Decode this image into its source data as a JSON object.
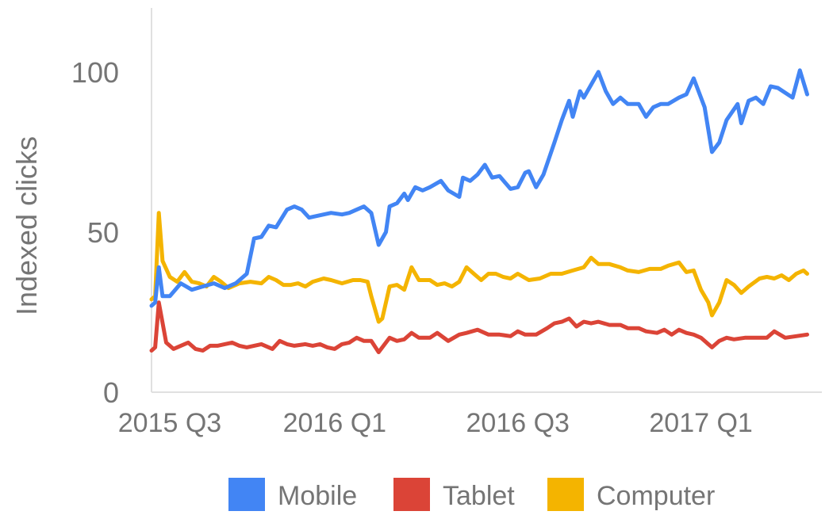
{
  "chart_data": {
    "type": "line",
    "ylabel": "Indexed clicks",
    "xlabel": "",
    "ylim": [
      0,
      120
    ],
    "y_ticks": [
      "0",
      "50",
      "100"
    ],
    "x_ticks": [
      "2015 Q3",
      "2016 Q1",
      "2016 Q3",
      "2017 Q1"
    ],
    "x_range": [
      2015.5,
      2017.33
    ],
    "grid": false,
    "legend_position": "bottom",
    "series": [
      {
        "name": "Mobile",
        "color": "#4285f4",
        "points": [
          [
            2015.5,
            27.0
          ],
          [
            2015.51,
            28.0
          ],
          [
            2015.52,
            39.0
          ],
          [
            2015.53,
            30.0
          ],
          [
            2015.55,
            30.0
          ],
          [
            2015.58,
            34.0
          ],
          [
            2015.61,
            32.0
          ],
          [
            2015.64,
            33.0
          ],
          [
            2015.67,
            34.0
          ],
          [
            2015.7,
            32.5
          ],
          [
            2015.73,
            34.0
          ],
          [
            2015.76,
            37.0
          ],
          [
            2015.78,
            48.0
          ],
          [
            2015.8,
            48.5
          ],
          [
            2015.82,
            52.0
          ],
          [
            2015.84,
            51.5
          ],
          [
            2015.87,
            57.0
          ],
          [
            2015.89,
            58.0
          ],
          [
            2015.91,
            57.0
          ],
          [
            2015.93,
            54.5
          ],
          [
            2015.95,
            55.0
          ],
          [
            2015.97,
            55.5
          ],
          [
            2015.99,
            56.0
          ],
          [
            2016.02,
            55.5
          ],
          [
            2016.04,
            56.0
          ],
          [
            2016.06,
            57.0
          ],
          [
            2016.08,
            58.0
          ],
          [
            2016.1,
            56.0
          ],
          [
            2016.12,
            46.0
          ],
          [
            2016.14,
            50.0
          ],
          [
            2016.15,
            58.0
          ],
          [
            2016.17,
            59.0
          ],
          [
            2016.19,
            62.0
          ],
          [
            2016.2,
            60.0
          ],
          [
            2016.22,
            64.0
          ],
          [
            2016.24,
            63.0
          ],
          [
            2016.26,
            64.0
          ],
          [
            2016.29,
            66.0
          ],
          [
            2016.31,
            63.0
          ],
          [
            2016.34,
            61.0
          ],
          [
            2016.35,
            67.0
          ],
          [
            2016.37,
            66.0
          ],
          [
            2016.39,
            68.0
          ],
          [
            2016.41,
            71.0
          ],
          [
            2016.43,
            67.0
          ],
          [
            2016.45,
            67.5
          ],
          [
            2016.48,
            63.5
          ],
          [
            2016.5,
            64.0
          ],
          [
            2016.52,
            68.5
          ],
          [
            2016.53,
            69.0
          ],
          [
            2016.55,
            64.0
          ],
          [
            2016.57,
            68.0
          ],
          [
            2016.6,
            78.0
          ],
          [
            2016.62,
            85.0
          ],
          [
            2016.64,
            91.0
          ],
          [
            2016.65,
            86.0
          ],
          [
            2016.67,
            94.0
          ],
          [
            2016.68,
            92.0
          ],
          [
            2016.7,
            96.0
          ],
          [
            2016.72,
            100.0
          ],
          [
            2016.74,
            94.0
          ],
          [
            2016.76,
            90.0
          ],
          [
            2016.78,
            92.0
          ],
          [
            2016.8,
            90.0
          ],
          [
            2016.83,
            90.0
          ],
          [
            2016.85,
            86.0
          ],
          [
            2016.87,
            89.0
          ],
          [
            2016.89,
            90.0
          ],
          [
            2016.91,
            90.0
          ],
          [
            2016.94,
            92.0
          ],
          [
            2016.96,
            93.0
          ],
          [
            2016.98,
            98.0
          ],
          [
            2017.01,
            89.0
          ],
          [
            2017.03,
            75.0
          ],
          [
            2017.05,
            78.0
          ],
          [
            2017.07,
            85.0
          ],
          [
            2017.1,
            90.0
          ],
          [
            2017.11,
            84.0
          ],
          [
            2017.13,
            91.0
          ],
          [
            2017.15,
            92.0
          ],
          [
            2017.17,
            90.0
          ],
          [
            2017.19,
            95.5
          ],
          [
            2017.21,
            95.0
          ],
          [
            2017.25,
            92.0
          ],
          [
            2017.27,
            100.5
          ],
          [
            2017.29,
            93.0
          ]
        ]
      },
      {
        "name": "Tablet",
        "color": "#db4437",
        "points": [
          [
            2015.5,
            13.0
          ],
          [
            2015.51,
            14.0
          ],
          [
            2015.52,
            28.0
          ],
          [
            2015.54,
            15.5
          ],
          [
            2015.56,
            13.5
          ],
          [
            2015.58,
            14.5
          ],
          [
            2015.6,
            15.5
          ],
          [
            2015.62,
            13.5
          ],
          [
            2015.64,
            13.0
          ],
          [
            2015.66,
            14.5
          ],
          [
            2015.68,
            14.5
          ],
          [
            2015.7,
            15.0
          ],
          [
            2015.72,
            15.5
          ],
          [
            2015.74,
            14.5
          ],
          [
            2015.76,
            14.0
          ],
          [
            2015.78,
            14.5
          ],
          [
            2015.8,
            15.0
          ],
          [
            2015.83,
            13.5
          ],
          [
            2015.85,
            16.0
          ],
          [
            2015.87,
            15.0
          ],
          [
            2015.89,
            14.5
          ],
          [
            2015.92,
            15.0
          ],
          [
            2015.94,
            14.5
          ],
          [
            2015.96,
            15.0
          ],
          [
            2015.98,
            14.0
          ],
          [
            2016.0,
            13.5
          ],
          [
            2016.02,
            15.0
          ],
          [
            2016.04,
            15.5
          ],
          [
            2016.06,
            17.0
          ],
          [
            2016.08,
            16.0
          ],
          [
            2016.1,
            16.0
          ],
          [
            2016.12,
            12.5
          ],
          [
            2016.15,
            17.0
          ],
          [
            2016.17,
            16.0
          ],
          [
            2016.19,
            16.5
          ],
          [
            2016.21,
            18.5
          ],
          [
            2016.23,
            17.0
          ],
          [
            2016.26,
            17.0
          ],
          [
            2016.28,
            18.5
          ],
          [
            2016.31,
            16.0
          ],
          [
            2016.34,
            18.0
          ],
          [
            2016.36,
            18.5
          ],
          [
            2016.39,
            19.5
          ],
          [
            2016.42,
            18.0
          ],
          [
            2016.45,
            18.0
          ],
          [
            2016.48,
            17.5
          ],
          [
            2016.5,
            19.0
          ],
          [
            2016.52,
            18.0
          ],
          [
            2016.55,
            18.0
          ],
          [
            2016.58,
            20.0
          ],
          [
            2016.6,
            21.5
          ],
          [
            2016.62,
            22.0
          ],
          [
            2016.64,
            23.0
          ],
          [
            2016.66,
            20.5
          ],
          [
            2016.68,
            22.0
          ],
          [
            2016.7,
            21.5
          ],
          [
            2016.72,
            22.0
          ],
          [
            2016.75,
            21.0
          ],
          [
            2016.78,
            21.0
          ],
          [
            2016.8,
            20.0
          ],
          [
            2016.83,
            20.0
          ],
          [
            2016.85,
            19.0
          ],
          [
            2016.88,
            18.5
          ],
          [
            2016.9,
            19.5
          ],
          [
            2016.92,
            18.0
          ],
          [
            2016.94,
            19.5
          ],
          [
            2016.96,
            18.5
          ],
          [
            2016.98,
            18.0
          ],
          [
            2017.0,
            17.0
          ],
          [
            2017.03,
            14.0
          ],
          [
            2017.05,
            16.0
          ],
          [
            2017.07,
            17.0
          ],
          [
            2017.09,
            16.5
          ],
          [
            2017.12,
            17.0
          ],
          [
            2017.15,
            17.0
          ],
          [
            2017.18,
            17.0
          ],
          [
            2017.2,
            19.0
          ],
          [
            2017.23,
            17.0
          ],
          [
            2017.26,
            17.5
          ],
          [
            2017.29,
            18.0
          ]
        ]
      },
      {
        "name": "Computer",
        "color": "#f4b400",
        "points": [
          [
            2015.5,
            29.0
          ],
          [
            2015.51,
            30.0
          ],
          [
            2015.52,
            56.0
          ],
          [
            2015.53,
            41.0
          ],
          [
            2015.55,
            36.0
          ],
          [
            2015.57,
            34.5
          ],
          [
            2015.59,
            37.5
          ],
          [
            2015.61,
            34.5
          ],
          [
            2015.63,
            34.0
          ],
          [
            2015.65,
            33.0
          ],
          [
            2015.67,
            36.0
          ],
          [
            2015.69,
            34.5
          ],
          [
            2015.71,
            32.5
          ],
          [
            2015.74,
            34.0
          ],
          [
            2015.77,
            34.5
          ],
          [
            2015.8,
            34.0
          ],
          [
            2015.82,
            36.0
          ],
          [
            2015.84,
            35.0
          ],
          [
            2015.86,
            33.5
          ],
          [
            2015.88,
            33.5
          ],
          [
            2015.9,
            34.0
          ],
          [
            2015.92,
            33.0
          ],
          [
            2015.94,
            34.5
          ],
          [
            2015.97,
            35.5
          ],
          [
            2015.99,
            35.0
          ],
          [
            2016.02,
            34.0
          ],
          [
            2016.05,
            35.0
          ],
          [
            2016.07,
            35.0
          ],
          [
            2016.09,
            34.5
          ],
          [
            2016.1,
            30.0
          ],
          [
            2016.12,
            22.0
          ],
          [
            2016.13,
            23.0
          ],
          [
            2016.15,
            33.0
          ],
          [
            2016.17,
            33.5
          ],
          [
            2016.19,
            32.0
          ],
          [
            2016.21,
            39.0
          ],
          [
            2016.23,
            35.0
          ],
          [
            2016.26,
            35.0
          ],
          [
            2016.28,
            33.5
          ],
          [
            2016.3,
            34.0
          ],
          [
            2016.32,
            33.0
          ],
          [
            2016.34,
            34.5
          ],
          [
            2016.36,
            39.0
          ],
          [
            2016.38,
            37.0
          ],
          [
            2016.4,
            35.0
          ],
          [
            2016.42,
            37.0
          ],
          [
            2016.44,
            37.0
          ],
          [
            2016.46,
            36.0
          ],
          [
            2016.48,
            35.5
          ],
          [
            2016.5,
            37.0
          ],
          [
            2016.53,
            35.0
          ],
          [
            2016.56,
            35.5
          ],
          [
            2016.59,
            37.0
          ],
          [
            2016.62,
            37.0
          ],
          [
            2016.65,
            38.0
          ],
          [
            2016.68,
            39.0
          ],
          [
            2016.7,
            42.0
          ],
          [
            2016.72,
            40.0
          ],
          [
            2016.75,
            40.0
          ],
          [
            2016.78,
            39.0
          ],
          [
            2016.8,
            38.0
          ],
          [
            2016.83,
            37.5
          ],
          [
            2016.86,
            38.5
          ],
          [
            2016.89,
            38.5
          ],
          [
            2016.91,
            39.5
          ],
          [
            2016.94,
            40.5
          ],
          [
            2016.96,
            37.5
          ],
          [
            2016.98,
            38.0
          ],
          [
            2017.0,
            32.0
          ],
          [
            2017.02,
            28.0
          ],
          [
            2017.03,
            24.0
          ],
          [
            2017.05,
            28.0
          ],
          [
            2017.07,
            35.0
          ],
          [
            2017.09,
            33.5
          ],
          [
            2017.11,
            31.0
          ],
          [
            2017.13,
            33.0
          ],
          [
            2017.16,
            35.5
          ],
          [
            2017.18,
            36.0
          ],
          [
            2017.2,
            35.5
          ],
          [
            2017.22,
            36.5
          ],
          [
            2017.24,
            35.0
          ],
          [
            2017.26,
            37.0
          ],
          [
            2017.28,
            38.0
          ],
          [
            2017.29,
            37.0
          ]
        ]
      }
    ]
  }
}
